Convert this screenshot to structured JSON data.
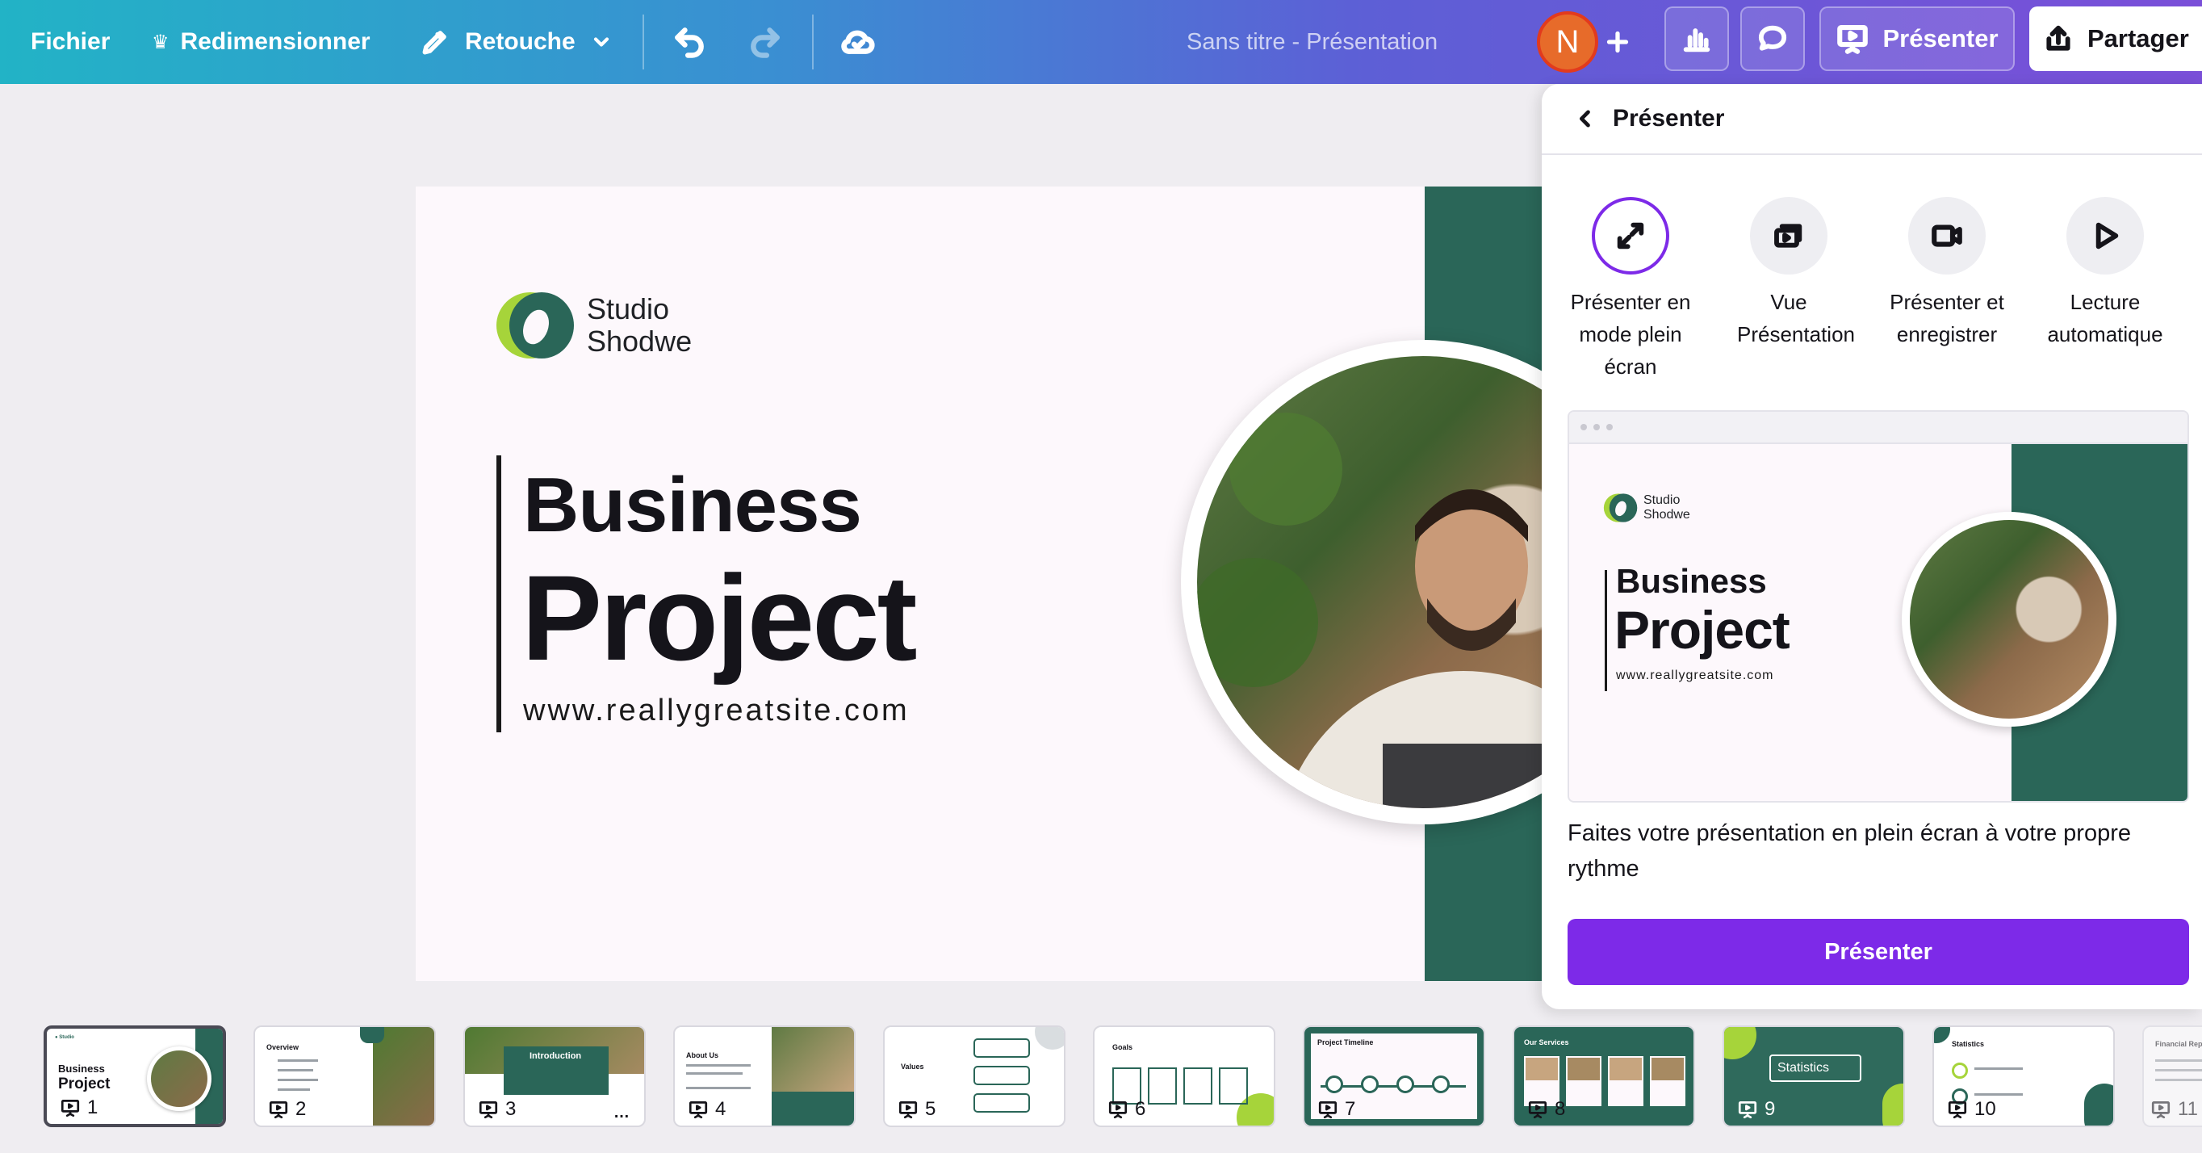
{
  "toolbar": {
    "file": "Fichier",
    "resize": "Redimensionner",
    "edit": "Retouche",
    "doc_title": "Sans titre - Présentation",
    "avatar_initial": "N",
    "present": "Présenter",
    "share": "Partager"
  },
  "slide": {
    "logo_line1": "Studio",
    "logo_line2": "Shodwe",
    "title1": "Business",
    "title2": "Project",
    "website": "www.reallygreatsite.com"
  },
  "panel": {
    "title": "Présenter",
    "options": [
      {
        "label": "Présenter en mode plein écran",
        "icon": "expand-arrows-icon",
        "selected": true
      },
      {
        "label": "Vue Présentation",
        "icon": "presenter-view-icon",
        "selected": false
      },
      {
        "label": "Présenter et enregistrer",
        "icon": "video-camera-icon",
        "selected": false
      },
      {
        "label": "Lecture automatique",
        "icon": "play-icon",
        "selected": false
      }
    ],
    "description": "Faites votre présentation en plein écran à votre propre rythme",
    "present_button": "Présenter"
  },
  "thumbnails": [
    {
      "num": "1",
      "title": "Business Project"
    },
    {
      "num": "2",
      "title": "Overview"
    },
    {
      "num": "3",
      "title": "Introduction"
    },
    {
      "num": "4",
      "title": "About Us"
    },
    {
      "num": "5",
      "title": "Values"
    },
    {
      "num": "6",
      "title": "Goals"
    },
    {
      "num": "7",
      "title": "Project Timeline"
    },
    {
      "num": "8",
      "title": "Our Services"
    },
    {
      "num": "9",
      "title": "Statistics"
    },
    {
      "num": "10",
      "title": "Statistics"
    },
    {
      "num": "11",
      "title": "Financial Report"
    }
  ],
  "colors": {
    "accent": "#7d2ae8",
    "slide_green": "#2a6658",
    "logo_lime": "#a6d43a",
    "avatar": "#e76b2a"
  }
}
